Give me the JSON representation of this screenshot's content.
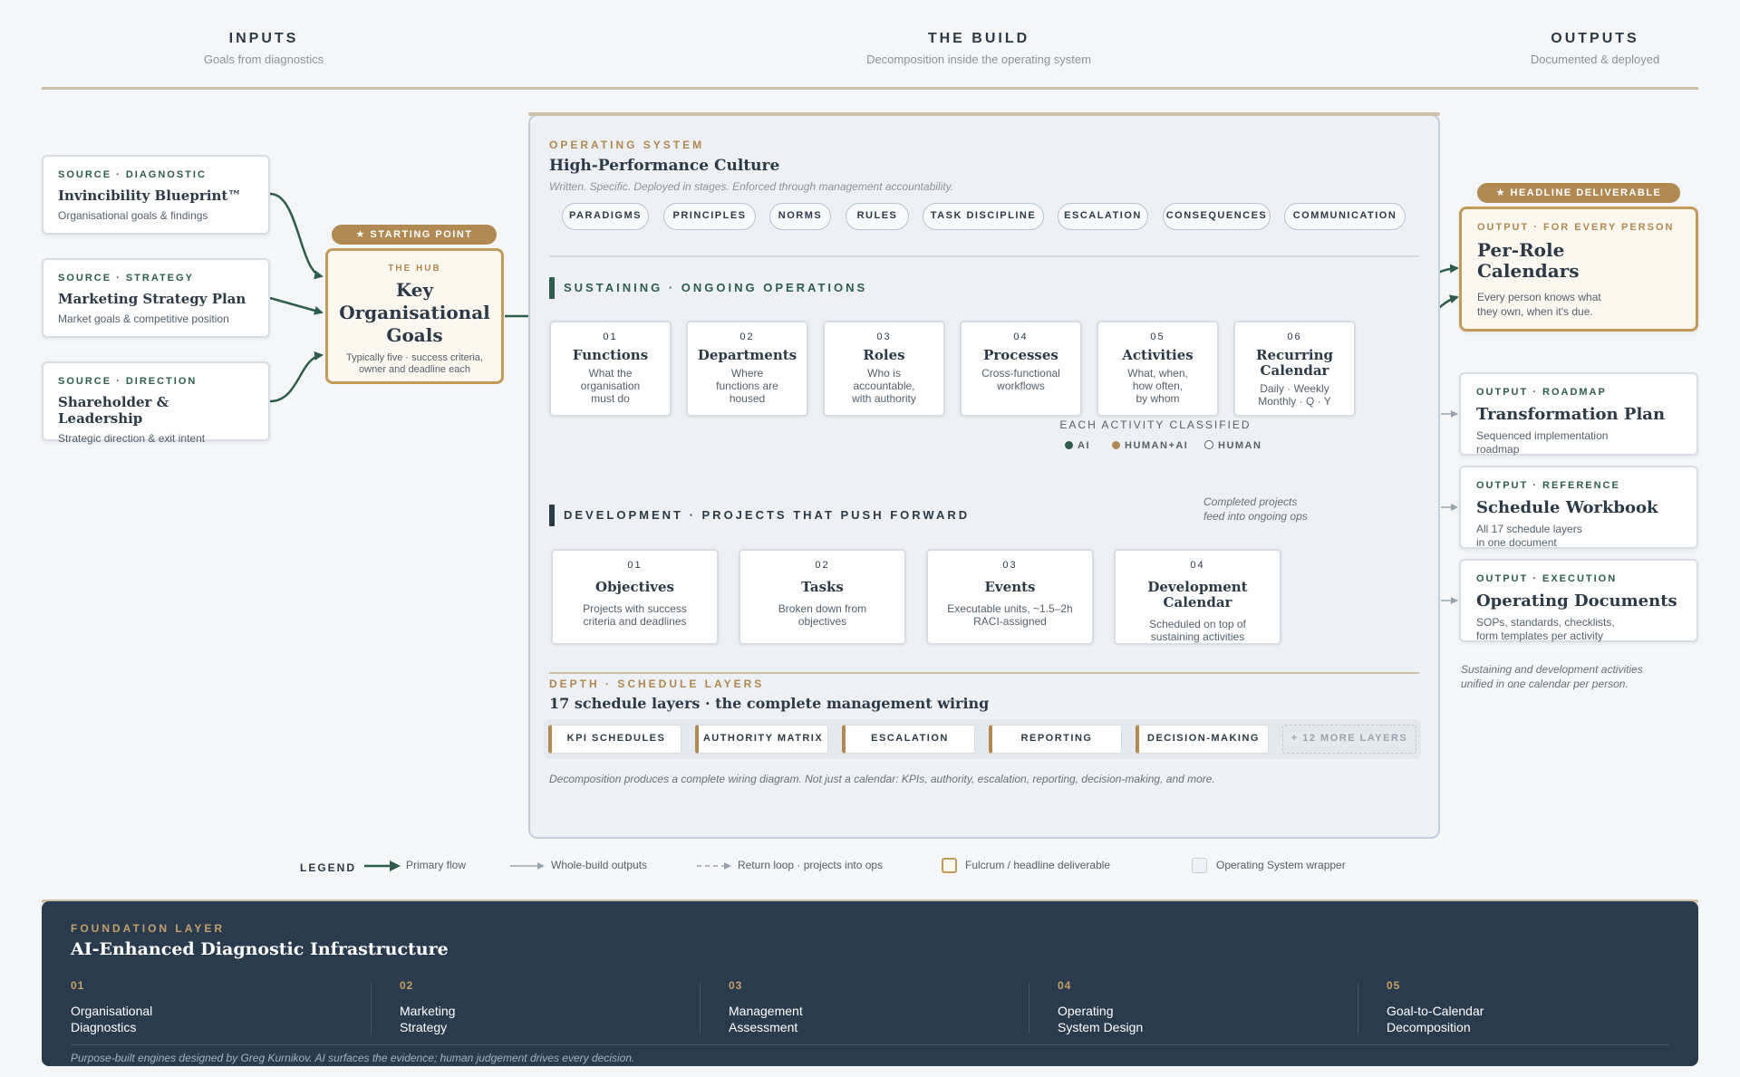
{
  "columns": {
    "inputs": {
      "title": "INPUTS",
      "subtitle": "Goals from diagnostics"
    },
    "build": {
      "title": "THE BUILD",
      "subtitle": "Decomposition inside the operating system"
    },
    "outputs": {
      "title": "OUTPUTS",
      "subtitle": "Documented & deployed"
    }
  },
  "sources": [
    {
      "tag": "SOURCE · DIAGNOSTIC",
      "title": "Invincibility Blueprint™",
      "desc": "Organisational goals & findings"
    },
    {
      "tag": "SOURCE · STRATEGY",
      "title": "Marketing Strategy Plan",
      "desc": "Market goals & competitive position"
    },
    {
      "tag": "SOURCE · DIRECTION",
      "title": "Shareholder & Leadership",
      "desc": "Strategic direction & exit intent"
    }
  ],
  "hub": {
    "badge": "★ STARTING POINT",
    "kicker": "THE HUB",
    "title_lines": [
      "Key",
      "Organisational",
      "Goals"
    ],
    "desc_lines": [
      "Typically five · success criteria,",
      "owner and deadline each"
    ]
  },
  "os": {
    "tag": "OPERATING SYSTEM",
    "title": "High-Performance Culture",
    "subtitle": "Written. Specific. Deployed in stages. Enforced through management accountability.",
    "pills": [
      "PARADIGMS",
      "PRINCIPLES",
      "NORMS",
      "RULES",
      "TASK DISCIPLINE",
      "ESCALATION",
      "CONSEQUENCES",
      "COMMUNICATION"
    ]
  },
  "sustaining": {
    "title": "SUSTAINING · ONGOING OPERATIONS",
    "steps": [
      {
        "num": "01",
        "title_lines": [
          "Functions"
        ],
        "desc_lines": [
          "What the",
          "organisation",
          "must do"
        ]
      },
      {
        "num": "02",
        "title_lines": [
          "Departments"
        ],
        "desc_lines": [
          "Where",
          "functions are",
          "housed"
        ]
      },
      {
        "num": "03",
        "title_lines": [
          "Roles"
        ],
        "desc_lines": [
          "Who is",
          "accountable,",
          "with authority"
        ]
      },
      {
        "num": "04",
        "title_lines": [
          "Processes"
        ],
        "desc_lines": [
          "Cross-functional",
          "workflows"
        ]
      },
      {
        "num": "05",
        "title_lines": [
          "Activities"
        ],
        "desc_lines": [
          "What, when,",
          "how often,",
          "by whom"
        ]
      },
      {
        "num": "06",
        "title_lines": [
          "Recurring",
          "Calendar"
        ],
        "desc_lines": [
          "Daily · Weekly",
          "Monthly · Q · Y"
        ]
      }
    ],
    "classify_title": "EACH ACTIVITY CLASSIFIED",
    "classes": [
      {
        "label": "AI",
        "color": "#2f5c4c"
      },
      {
        "label": "HUMAN+AI",
        "color": "#b08a52"
      },
      {
        "label": "HUMAN",
        "color": "#ffffff"
      }
    ]
  },
  "loop_note": [
    "Completed projects",
    "feed into ongoing ops"
  ],
  "development": {
    "title": "DEVELOPMENT · PROJECTS THAT PUSH FORWARD",
    "steps": [
      {
        "num": "01",
        "title": "Objectives",
        "desc_lines": [
          "Projects with success",
          "criteria and deadlines"
        ]
      },
      {
        "num": "02",
        "title": "Tasks",
        "desc_lines": [
          "Broken down from",
          "objectives"
        ]
      },
      {
        "num": "03",
        "title": "Events",
        "desc_lines": [
          "Executable units, ~1.5–2h",
          "RACI-assigned"
        ]
      },
      {
        "num": "04",
        "title": "Development Calendar",
        "desc_lines": [
          "Scheduled on top of",
          "sustaining activities"
        ]
      }
    ]
  },
  "depth": {
    "tag": "DEPTH · SCHEDULE LAYERS",
    "title": "17 schedule layers · the complete management wiring",
    "layers": [
      "KPI SCHEDULES",
      "AUTHORITY MATRIX",
      "ESCALATION",
      "REPORTING",
      "DECISION-MAKING"
    ],
    "more": "+ 12 MORE LAYERS",
    "note": "Decomposition produces a complete wiring diagram. Not just a calendar: KPIs, authority, escalation, reporting, decision-making, and more."
  },
  "outputs": {
    "headline_badge": "★ HEADLINE DELIVERABLE",
    "headline": {
      "tag": "OUTPUT · FOR EVERY PERSON",
      "title_lines": [
        "Per-Role",
        "Calendars"
      ],
      "desc_lines": [
        "Every person knows what",
        "they own, when it's due."
      ]
    },
    "items": [
      {
        "tag": "OUTPUT · ROADMAP",
        "title": "Transformation Plan",
        "desc_lines": [
          "Sequenced implementation",
          "roadmap"
        ]
      },
      {
        "tag": "OUTPUT · REFERENCE",
        "title": "Schedule Workbook",
        "desc_lines": [
          "All 17 schedule layers",
          "in one document"
        ]
      },
      {
        "tag": "OUTPUT · EXECUTION",
        "title": "Operating Documents",
        "desc_lines": [
          "SOPs, standards, checklists,",
          "form templates per activity"
        ]
      }
    ],
    "note_lines": [
      "Sustaining and development activities",
      "unified in one calendar per person."
    ]
  },
  "legend": {
    "title": "LEGEND",
    "primary": "Primary flow",
    "whole": "Whole-build outputs",
    "return": "Return loop · projects into ops",
    "fulcrum": "Fulcrum / headline deliverable",
    "wrapper": "Operating System wrapper"
  },
  "foundation": {
    "tag": "FOUNDATION LAYER",
    "title": "AI-Enhanced Diagnostic Infrastructure",
    "items": [
      {
        "num": "01",
        "lines": [
          "Organisational",
          "Diagnostics"
        ]
      },
      {
        "num": "02",
        "lines": [
          "Marketing",
          "Strategy"
        ]
      },
      {
        "num": "03",
        "lines": [
          "Management",
          "Assessment"
        ]
      },
      {
        "num": "04",
        "lines": [
          "Operating",
          "System Design"
        ]
      },
      {
        "num": "05",
        "lines": [
          "Goal-to-Calendar",
          "Decomposition"
        ]
      }
    ],
    "footer": "Purpose-built engines designed by Greg Kurnikov. AI surfaces the evidence; human judgement drives every decision."
  },
  "colors": {
    "green": "#2f5c4c",
    "gold": "#b08a52",
    "navy": "#2b3b4e",
    "grey_arrow": "#9aa4ae"
  }
}
